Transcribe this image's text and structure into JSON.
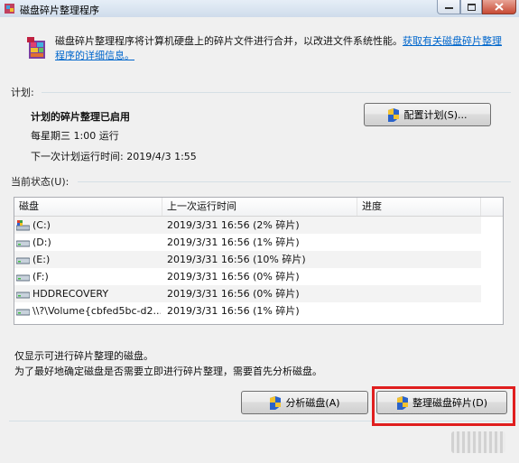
{
  "window": {
    "title": "磁盘碎片整理程序",
    "icon": "defrag-icon"
  },
  "header": {
    "description": "磁盘碎片整理程序将计算机硬盘上的碎片文件进行合并，以改进文件系统性能。",
    "link": "获取有关磁盘碎片整理程序的详细信息。"
  },
  "schedule": {
    "section_label": "计划:",
    "status": "计划的碎片整理已启用",
    "frequency": "每星期三  1:00 运行",
    "next_run": "下一次计划运行时间: 2019/4/3 1:55",
    "configure_button": "配置计划(S)..."
  },
  "current_status": {
    "section_label": "当前状态(U):",
    "columns": [
      "磁盘",
      "上一次运行时间",
      "进度"
    ],
    "rows": [
      {
        "disk": "(C:)",
        "last_run": "2019/3/31 16:56 (2% 碎片)",
        "progress": "",
        "icon": "system-drive-icon"
      },
      {
        "disk": "(D:)",
        "last_run": "2019/3/31 16:56 (1% 碎片)",
        "progress": "",
        "icon": "drive-icon"
      },
      {
        "disk": "(E:)",
        "last_run": "2019/3/31 16:56 (10% 碎片)",
        "progress": "",
        "icon": "drive-icon"
      },
      {
        "disk": "(F:)",
        "last_run": "2019/3/31 16:56 (0% 碎片)",
        "progress": "",
        "icon": "drive-icon"
      },
      {
        "disk": "HDDRECOVERY",
        "last_run": "2019/3/31 16:56 (0% 碎片)",
        "progress": "",
        "icon": "drive-icon"
      },
      {
        "disk": "\\\\?\\Volume{cbfed5bc-d2...",
        "last_run": "2019/3/31 16:56 (1% 碎片)",
        "progress": "",
        "icon": "drive-icon"
      }
    ]
  },
  "notes": {
    "line1": "仅显示可进行碎片整理的磁盘。",
    "line2": "为了最好地确定磁盘是否需要立即进行碎片整理，需要首先分析磁盘。"
  },
  "actions": {
    "analyze_button": "分析磁盘(A)",
    "defragment_button": "整理磁盘碎片(D)"
  },
  "colors": {
    "link": "#0066cc",
    "highlight": "#e01e1e"
  }
}
